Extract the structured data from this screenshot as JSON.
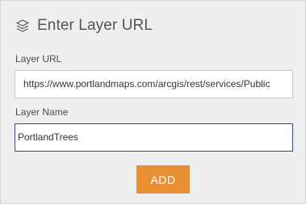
{
  "panel": {
    "title": "Enter Layer URL",
    "title_icon": "layers-icon"
  },
  "form": {
    "layer_url_label": "Layer URL",
    "layer_url_value": "https://www.portlandmaps.com/arcgis/rest/services/Public",
    "layer_name_label": "Layer Name",
    "layer_name_value": "PortlandTrees",
    "add_label": "ADD"
  },
  "colors": {
    "panel_background": "#efefef",
    "add_button": "#e98f33",
    "focused_input_border": "#2f4f86"
  }
}
